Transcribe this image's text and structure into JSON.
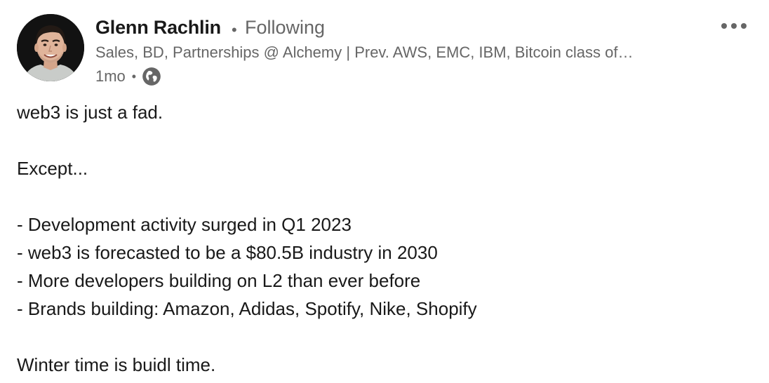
{
  "post": {
    "author": {
      "name": "Glenn Rachlin",
      "follow_status": "Following",
      "headline": "Sales, BD, Partnerships @ Alchemy | Prev. AWS, EMC, IBM, Bitcoin class of…",
      "avatar_icon": "person-photo"
    },
    "separator": "•",
    "timestamp": "1mo",
    "visibility_icon": "globe-icon",
    "more_icon": "ellipsis-icon",
    "body": {
      "line1": "web3 is just a fad.",
      "line2": "Except...",
      "bullets": [
        "- Development activity surged in Q1 2023",
        "- web3 is forecasted to be a $80.5B industry in 2030",
        "- More developers building on L2 than ever before",
        "- Brands building: Amazon, Adidas, Spotify, Nike, Shopify"
      ],
      "closing": "Winter time is buidl time."
    }
  },
  "colors": {
    "text_primary": "#191919",
    "text_secondary": "#666666",
    "background": "#ffffff"
  }
}
